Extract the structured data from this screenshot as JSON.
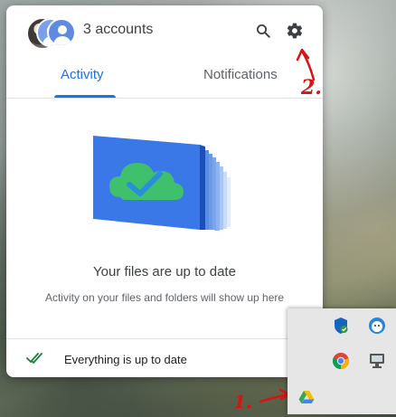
{
  "header": {
    "accounts_label": "3 accounts",
    "icons": [
      "search-icon",
      "gear-icon"
    ]
  },
  "tabs": [
    {
      "label": "Activity",
      "active": true
    },
    {
      "label": "Notifications",
      "active": false
    }
  ],
  "main": {
    "title": "Your files are up to date",
    "subtitle": "Activity on your files and folders will show up here"
  },
  "footer": {
    "status_text": "Everything is up to date",
    "icon": "double-check-icon"
  },
  "annotations": {
    "step_1": "1.",
    "step_2": "2."
  },
  "tray": {
    "icons": [
      "shield-icon",
      "face-icon",
      "chrome-icon",
      "network-icon",
      "google-drive-icon"
    ]
  },
  "colors": {
    "accent": "#1a73e8",
    "annotation": "#d81313",
    "check_green": "#188038"
  }
}
